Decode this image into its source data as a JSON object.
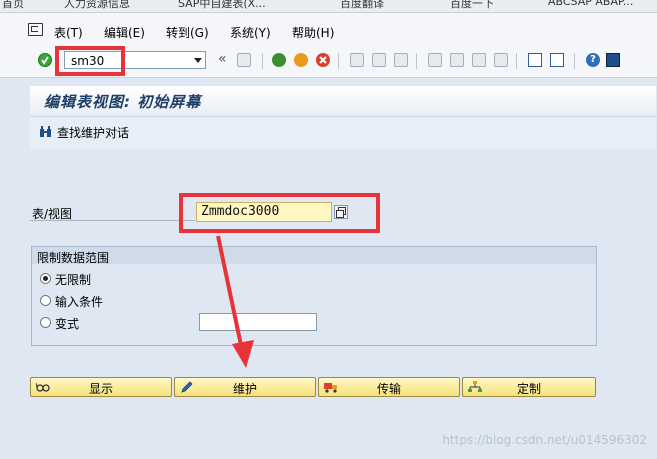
{
  "browser_tabs": [
    "首页",
    "人力资源信息",
    "SAP中自建表(X...",
    "百度翻译",
    "百度一下",
    "ABCSAP ABAP..."
  ],
  "menubar": {
    "items": [
      "表(T)",
      "编辑(E)",
      "转到(G)",
      "系统(Y)",
      "帮助(H)"
    ]
  },
  "toolbar": {
    "command_value": "sm30",
    "icons": [
      "enter-check-icon",
      "back-double-icon",
      "save-icon",
      "back-icon",
      "exit-icon",
      "cancel-icon",
      "print-icon",
      "find-icon",
      "find-next-icon",
      "first-page-icon",
      "prev-page-icon",
      "next-page-icon",
      "last-page-icon",
      "create-session-icon",
      "shortcut-icon",
      "help-icon",
      "layout-menu-icon"
    ]
  },
  "title": "编辑表视图: 初始屏幕",
  "app_toolbar": {
    "find_label": "查找维护对话"
  },
  "form": {
    "table_label": "表/视图",
    "table_value": "Zmmdoc3000"
  },
  "restrict_group": {
    "title": "限制数据范围",
    "options": [
      {
        "label": "无限制",
        "selected": true
      },
      {
        "label": "输入条件",
        "selected": false
      },
      {
        "label": "变式",
        "selected": false
      }
    ],
    "variant_value": ""
  },
  "actions": {
    "display": "显示",
    "maintain": "维护",
    "transport": "传输",
    "customize": "定制"
  },
  "colors": {
    "highlight": "#e8333a",
    "arrow": "#e8333a",
    "title_text": "#1f3f66",
    "button_fill": "#f6e27a"
  },
  "watermark": "https://blog.csdn.net/u014596302"
}
